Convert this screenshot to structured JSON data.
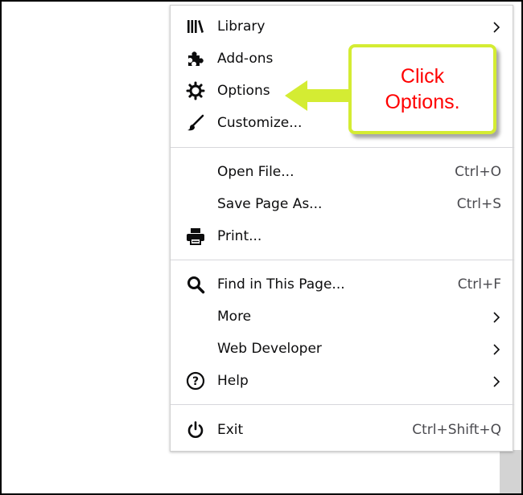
{
  "menu": {
    "items": [
      {
        "label": "Library",
        "icon": "library-icon",
        "submenu": true
      },
      {
        "label": "Add-ons",
        "icon": "puzzle-icon"
      },
      {
        "label": "Options",
        "icon": "gear-icon"
      },
      {
        "label": "Customize...",
        "icon": "paintbrush-icon"
      },
      {
        "label": "Open File...",
        "shortcut": "Ctrl+O"
      },
      {
        "label": "Save Page As...",
        "shortcut": "Ctrl+S"
      },
      {
        "label": "Print...",
        "icon": "printer-icon"
      },
      {
        "label": "Find in This Page...",
        "icon": "search-icon",
        "shortcut": "Ctrl+F"
      },
      {
        "label": "More",
        "submenu": true
      },
      {
        "label": "Web Developer",
        "submenu": true
      },
      {
        "label": "Help",
        "icon": "help-icon",
        "submenu": true
      },
      {
        "label": "Exit",
        "icon": "power-icon",
        "shortcut": "Ctrl+Shift+Q"
      }
    ]
  },
  "callout": {
    "line1": "Click",
    "line2": "Options.",
    "text_color": "#ff0000",
    "border_color": "#d4ec33"
  },
  "colors": {
    "arrow": "#d4ec33",
    "menu_text": "#0c0c0d",
    "shortcut_text": "#4a4a4f",
    "separator": "#d7d7db"
  }
}
